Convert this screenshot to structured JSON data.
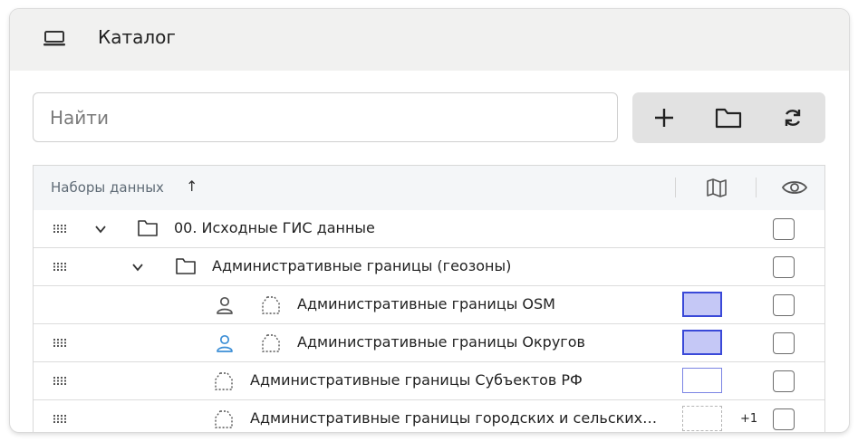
{
  "header": {
    "title": "Каталог",
    "logo_icon": "laptop-icon"
  },
  "search": {
    "placeholder": "Найти",
    "value": ""
  },
  "toolbar": {
    "buttons": [
      {
        "name": "add-button",
        "icon": "plus-icon"
      },
      {
        "name": "add-folder-button",
        "icon": "folder-icon"
      },
      {
        "name": "refresh-button",
        "icon": "refresh-icon"
      }
    ]
  },
  "table": {
    "header": {
      "column_label": "Наборы данных",
      "sort_indicator": "↑",
      "map_column_icon": "map-icon",
      "visibility_column_icon": "eye-icon"
    },
    "rows": [
      {
        "text": "00. Исходные ГИС данные",
        "type": "folder",
        "level": 0,
        "expanded": true,
        "checked": false
      },
      {
        "text": "Административные границы (геозоны)",
        "type": "folder",
        "level": 1,
        "expanded": true,
        "checked": false
      },
      {
        "text": "Административные границы OSM",
        "type": "layer",
        "has_owner_icon": true,
        "owner_color": "#555555",
        "swatch": "#c5c8f6",
        "swatch_border": "#3a49d8",
        "checked": false
      },
      {
        "text": "Административные границы Округов",
        "type": "layer",
        "has_owner_icon": true,
        "owner_color": "#3d8fd6",
        "swatch": "#c5c8f6",
        "swatch_border": "#3a49d8",
        "checked": false
      },
      {
        "text": "Административные границы Субъектов РФ",
        "type": "layer",
        "has_owner_icon": false,
        "swatch": "#ffffff",
        "swatch_border": "#7b84e4",
        "checked": false
      },
      {
        "text": "Административные границы городских и сельских…",
        "type": "layer",
        "has_owner_icon": false,
        "swatch": "#ffffff",
        "swatch_border": "#b5b5b5",
        "swatch_dashed": true,
        "extra": "+1",
        "checked": false
      }
    ]
  }
}
